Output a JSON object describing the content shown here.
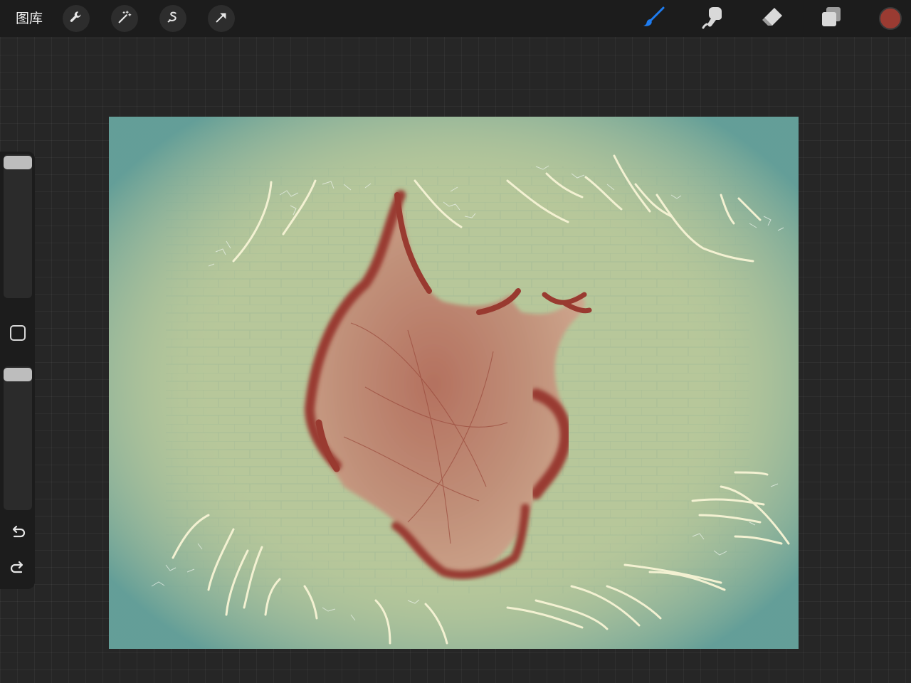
{
  "toolbar": {
    "gallery_label": "图库",
    "left_tools": [
      {
        "name": "actions",
        "icon": "wrench-icon"
      },
      {
        "name": "adjustments",
        "icon": "magic-wand-icon"
      },
      {
        "name": "selection",
        "icon": "selection-s-icon"
      },
      {
        "name": "transform",
        "icon": "arrow-cursor-icon"
      }
    ],
    "right_tools": [
      {
        "name": "brush",
        "icon": "brush-icon",
        "active": true
      },
      {
        "name": "smudge",
        "icon": "smudge-finger-icon"
      },
      {
        "name": "eraser",
        "icon": "eraser-icon"
      },
      {
        "name": "layers",
        "icon": "layers-icon"
      }
    ],
    "active_color": "#9a3b32",
    "active_tool_color": "#1e7cf0"
  },
  "sidebar": {
    "brush_size_label": "",
    "opacity_label": "",
    "icons": [
      "modify-square-icon",
      "undo-icon",
      "redo-icon"
    ]
  },
  "canvas": {
    "background_color": "#b7c79a",
    "vignette_color": "#5f9c98",
    "shape_color": "#9a3b32",
    "stroke_color": "#f3f1d2"
  }
}
